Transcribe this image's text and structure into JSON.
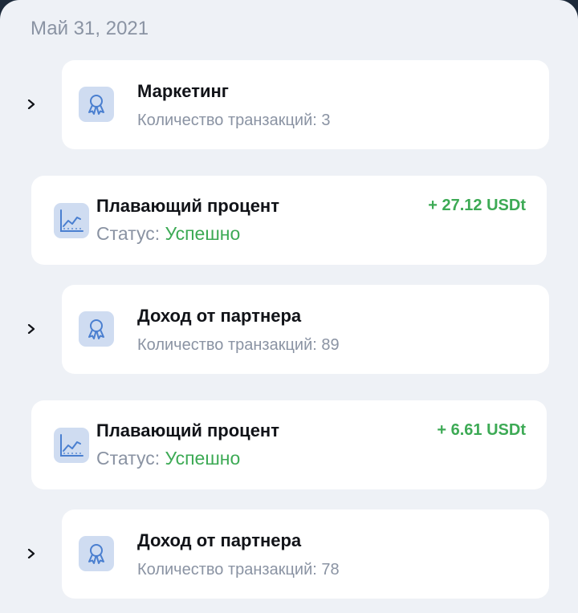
{
  "date_header": "Май 31, 2021",
  "colors": {
    "background": "#eef1f6",
    "card": "#ffffff",
    "accent_green": "#3daa55",
    "icon_blue": "#4a7fd0",
    "icon_bg": "#cfdcf1",
    "muted_text": "#8a93a3"
  },
  "rows": [
    {
      "kind": "group",
      "icon": "award-icon",
      "title": "Маркетинг",
      "subtitle": "Количество транзакций: 3"
    },
    {
      "kind": "transaction",
      "icon": "chart-trend-icon",
      "title": "Плавающий процент",
      "status_label": "Статус:",
      "status_value": "Успешно",
      "amount": "+ 27.12 USDt"
    },
    {
      "kind": "group",
      "icon": "award-icon",
      "title": "Доход от партнера",
      "subtitle": "Количество транзакций: 89"
    },
    {
      "kind": "transaction",
      "icon": "chart-trend-icon",
      "title": "Плавающий процент",
      "status_label": "Статус:",
      "status_value": "Успешно",
      "amount": "+ 6.61 USDt"
    },
    {
      "kind": "group",
      "icon": "award-icon",
      "title": "Доход от партнера",
      "subtitle": "Количество транзакций: 78"
    }
  ]
}
